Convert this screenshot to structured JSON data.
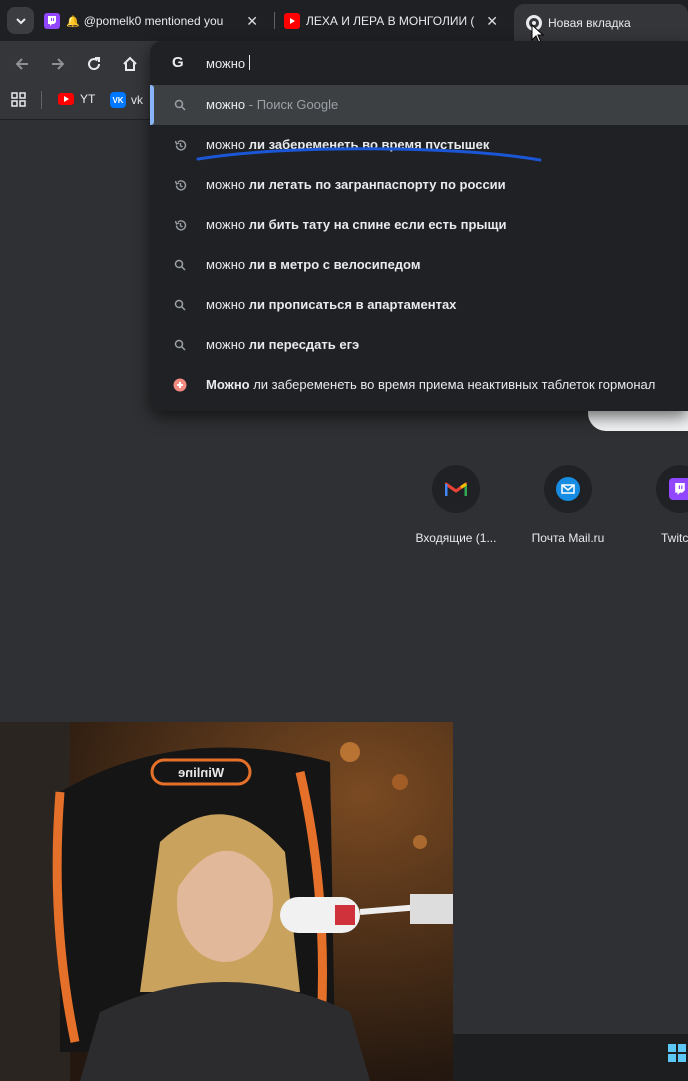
{
  "tabs": [
    {
      "title": "@pomelk0 mentioned you",
      "favicon": "twitch-icon",
      "prefix": "bell-icon"
    },
    {
      "title": "ЛЕХА И ЛЕРА В МОНГОЛИИ (",
      "favicon": "youtube-icon"
    },
    {
      "title": "Новая вкладка",
      "favicon": "chrome-icon"
    }
  ],
  "tab_close_glyph": "✕",
  "omnibox": {
    "value": "можно",
    "engine_icon": "G"
  },
  "suggestions": [
    {
      "icon": "search-icon",
      "pre": "можно",
      "bold": "",
      "post": " - Поиск Google",
      "post_gray": true,
      "selected": true
    },
    {
      "icon": "history-icon",
      "pre": "можно ",
      "bold": "ли забеременеть во время пустышек",
      "post": ""
    },
    {
      "icon": "history-icon",
      "pre": "можно ",
      "bold": "ли летать по загранпаспорту по россии",
      "post": ""
    },
    {
      "icon": "history-icon",
      "pre": "можно ",
      "bold": "ли бить тату на спине если есть прыщи",
      "post": ""
    },
    {
      "icon": "search-icon",
      "pre": "можно ",
      "bold": "ли в метро с велосипедом",
      "post": ""
    },
    {
      "icon": "search-icon",
      "pre": "можно ",
      "bold": "ли прописаться в апартаментах",
      "post": ""
    },
    {
      "icon": "search-icon",
      "pre": "можно ",
      "bold": "ли пересдать егэ",
      "post": ""
    },
    {
      "icon": "site-icon",
      "pre": "",
      "bold": "Можно",
      "post": " ли забеременеть во время приема неактивных таблеток гормонал"
    }
  ],
  "bookmarks": [
    {
      "label": "YT",
      "icon": "youtube-icon"
    },
    {
      "label": "vk",
      "icon": "vk-icon"
    }
  ],
  "shortcuts": [
    {
      "label": "Входящие (1...",
      "icon": "gmail-icon"
    },
    {
      "label": "Почта Mail.ru",
      "icon": "mail-icon"
    },
    {
      "label": "Twitc",
      "icon": "twitch-icon"
    }
  ],
  "webcam": {
    "chair_brand": "Winline"
  },
  "colors": {
    "accent": "#8ab4f8",
    "youtube": "#ff0000",
    "twitch": "#9146ff",
    "vk": "#0077ff",
    "annotation": "#1a56d6"
  }
}
